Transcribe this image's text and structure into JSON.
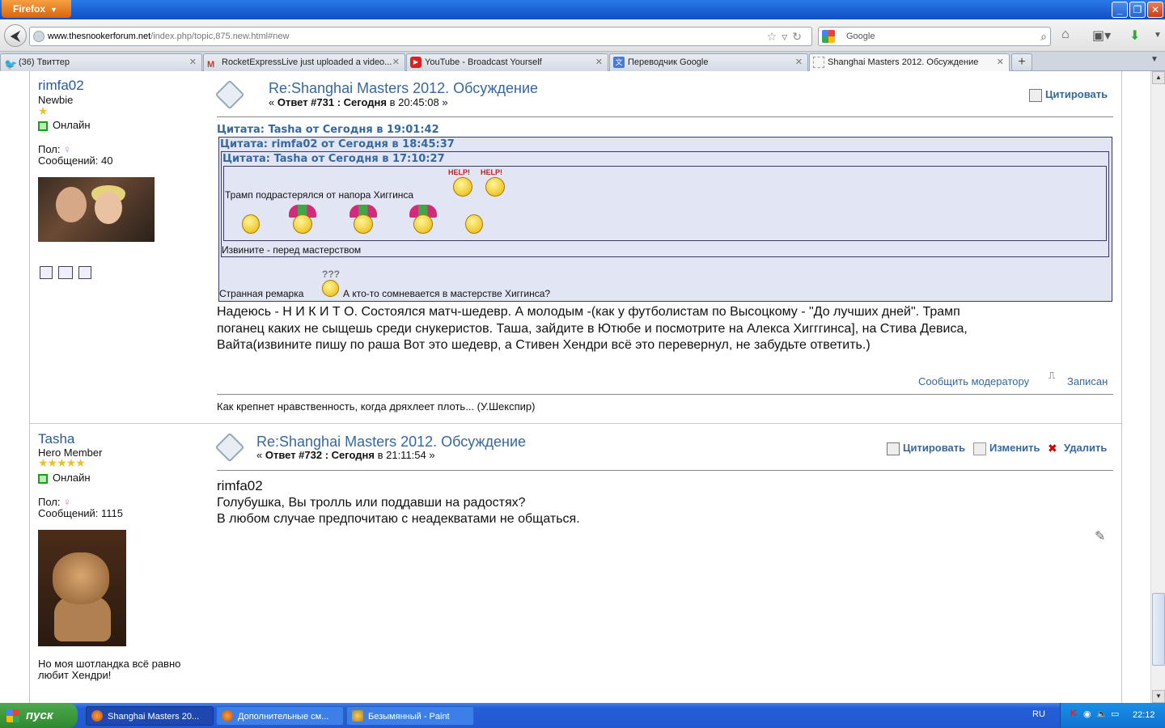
{
  "browser": {
    "firefox_menu": "Firefox",
    "url_host": "www.thesnookerforum.net",
    "url_path": "/index.php/topic,875.new.html#new",
    "search_placeholder": "Google",
    "tabs": [
      {
        "label": "(36) Твиттер",
        "icon": "twitter-icon"
      },
      {
        "label": "RocketExpressLive just uploaded a video...",
        "icon": "gmail-icon"
      },
      {
        "label": "YouTube - Broadcast Yourself",
        "icon": "youtube-icon"
      },
      {
        "label": "Переводчик Google",
        "icon": "google-translate-icon"
      },
      {
        "label": "Shanghai Masters 2012. Обсуждение",
        "icon": "page-icon"
      }
    ]
  },
  "post1": {
    "username": "rimfa02",
    "rank": "Newbie",
    "stars": "★",
    "status": "Онлайн",
    "gender_label": "Пол:",
    "messages": "Сообщений: 40",
    "title": "Re:Shanghai Masters 2012. Обсуждение",
    "reply_prefix": "« ",
    "reply_bold": "Ответ #731 : Сегодня",
    "reply_time": " в 20:45:08 »",
    "quote_action": "Цитировать",
    "quote1_header": "Цитата: Tasha от Сегодня в 19:01:42",
    "quote2_header": "Цитата: rimfa02 от Сегодня в 18:45:37",
    "quote3_header": "Цитата: Tasha от Сегодня в 17:10:27",
    "quote3_text": "Трамп подрастерялся от напора Хиггинса",
    "help_text": "HELP!",
    "quote2_text": "Извините - перед мастерством",
    "quote1_text_a": "Странная ремарка",
    "question_marks": "???",
    "quote1_text_b": "А кто-то сомневается в мастерстве Хиггинса?",
    "body_line1": "Надеюсь - Н И К И Т О. Состоялся матч-шедевр. А молодым -(как у футболистам по Высоцкому - \"До лучших дней\". Трамп",
    "body_line2": "поганец каких не сыщешь  среди снукеристов. Таша, зайдите в Ютюбе и посмотрите на Алекса Хигггинса], на Стива Девиса,",
    "body_line3": "Вайта(извините пишу по раша Вот это шедевр, а Стивен Хендри всё это перевернул, не забудьте ответить.)",
    "report": "Сообщить модератору",
    "logged": "Записан",
    "signature": "Как крепнет нравственность, когда дряхлеет плоть... (У.Шекспир)"
  },
  "post2": {
    "username": "Tasha",
    "rank": "Hero Member",
    "stars": "★★★★★",
    "status": "Онлайн",
    "gender_label": "Пол:",
    "messages": "Сообщений: 1115",
    "personal_text_1": "Но моя шотландка всё равно",
    "personal_text_2": "любит Хендри!",
    "title": "Re:Shanghai Masters 2012. Обсуждение",
    "reply_prefix": "« ",
    "reply_bold": "Ответ #732 : Сегодня",
    "reply_time": " в 21:11:54 »",
    "quote_action": "Цитировать",
    "edit_action": "Изменить",
    "delete_action": "Удалить",
    "body_name": "rimfa02",
    "body_line1": "Голубушка, Вы тролль или поддавши на радостях?",
    "body_line2": "В любом случае предпочитаю с неадекватами не общаться."
  },
  "taskbar": {
    "start": "пуск",
    "tasks": [
      "Shanghai Masters 20...",
      "Дополнительные см...",
      "Безымянный - Paint"
    ],
    "lang": "RU",
    "clock": "22:12"
  },
  "colors": {
    "link": "#3568a0",
    "quote_bg": "#e2e6f4",
    "taskbar": "#245ed8"
  }
}
